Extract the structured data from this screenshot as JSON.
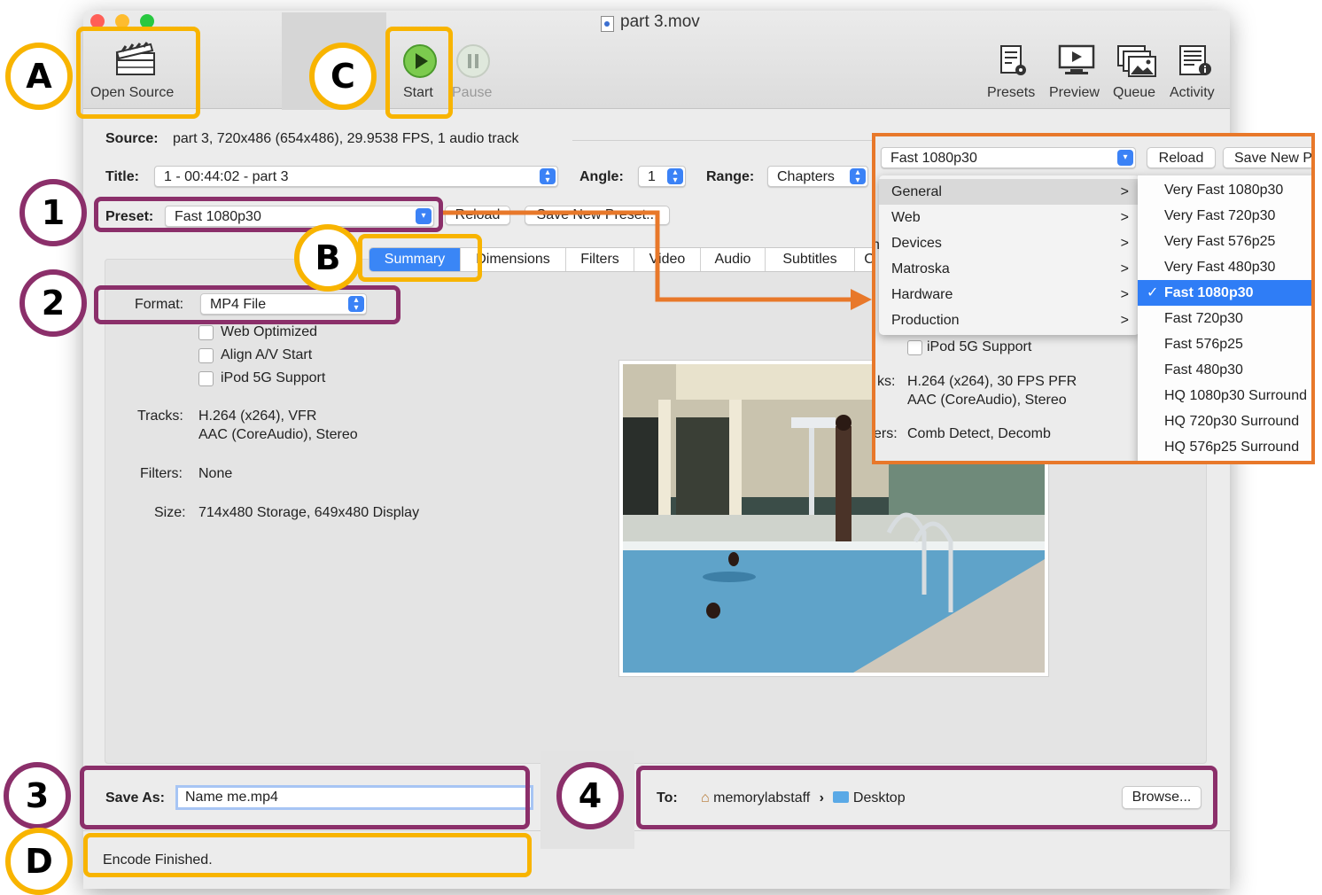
{
  "window": {
    "title": "part 3.mov"
  },
  "toolbar": {
    "open_source": "Open Source",
    "start": "Start",
    "pause": "Pause",
    "presets": "Presets",
    "preview": "Preview",
    "queue": "Queue",
    "activity": "Activity"
  },
  "source": {
    "label": "Source:",
    "value": "part 3, 720x486 (654x486), 29.9538 FPS, 1 audio track"
  },
  "title_row": {
    "title_label": "Title:",
    "title_value": "1 - 00:44:02 - part 3",
    "angle_label": "Angle:",
    "angle_value": "1",
    "range_label": "Range:",
    "range_value": "Chapters"
  },
  "preset_row": {
    "label": "Preset:",
    "value": "Fast 1080p30",
    "reload": "Reload",
    "save_new": "Save New Preset..."
  },
  "tabs": [
    "Summary",
    "Dimensions",
    "Filters",
    "Video",
    "Audio",
    "Subtitles",
    "C"
  ],
  "summary": {
    "format_label": "Format:",
    "format_value": "MP4 File",
    "web_optimized": "Web Optimized",
    "align_av": "Align A/V Start",
    "ipod": "iPod 5G Support",
    "tracks_label": "Tracks:",
    "tracks_line1": "H.264 (x264), VFR",
    "tracks_line2": "AAC (CoreAudio), Stereo",
    "filters_label": "Filters:",
    "filters_value": "None",
    "size_label": "Size:",
    "size_value": "714x480 Storage, 649x480 Display"
  },
  "save": {
    "label": "Save As:",
    "value": "Name me.mp4"
  },
  "destination": {
    "label": "To:",
    "user": "memorylabstaff",
    "separator": "›",
    "folder": "Desktop",
    "browse": "Browse..."
  },
  "status": "Encode Finished.",
  "inset": {
    "preset_value": "Fast 1080p30",
    "reload": "Reload",
    "save_new": "Save New P",
    "categories": [
      "General",
      "Web",
      "Devices",
      "Matroska",
      "Hardware",
      "Production"
    ],
    "presets": [
      "Very Fast 1080p30",
      "Very Fast 720p30",
      "Very Fast 576p25",
      "Very Fast 480p30",
      "Fast 1080p30",
      "Fast 720p30",
      "Fast 576p25",
      "Fast 480p30",
      "HQ 1080p30 Surround",
      "HQ 720p30 Surround",
      "HQ 576p25 Surround"
    ],
    "selected_check": "✓",
    "chevron": ">",
    "bg_ipod": "iPod 5G Support",
    "bg_tracks_label": "ks:",
    "bg_tracks_line1": "H.264 (x264), 30 FPS PFR",
    "bg_tracks_line2": "AAC (CoreAudio), Stereo",
    "bg_filters_label": "ers:",
    "bg_filters_value": "Comb Detect, Decomb",
    "bg_h": "h"
  },
  "callouts": {
    "A": "A",
    "B": "B",
    "C": "C",
    "D": "D",
    "n1": "1",
    "n2": "2",
    "n3": "3",
    "n4": "4"
  },
  "colors": {
    "purple_outline": "#8b2f6a",
    "yellow_outline": "#f8b400",
    "orange_arrow": "#e8782a",
    "accent_blue": "#2f7df6"
  }
}
